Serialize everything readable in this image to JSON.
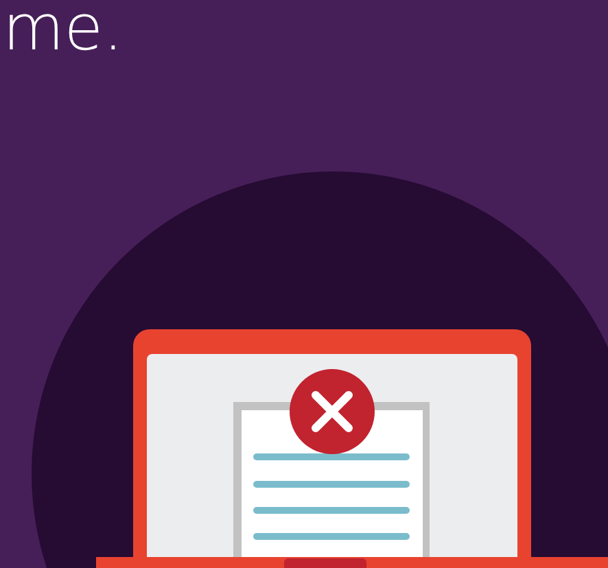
{
  "heading": {
    "text": "me."
  }
}
